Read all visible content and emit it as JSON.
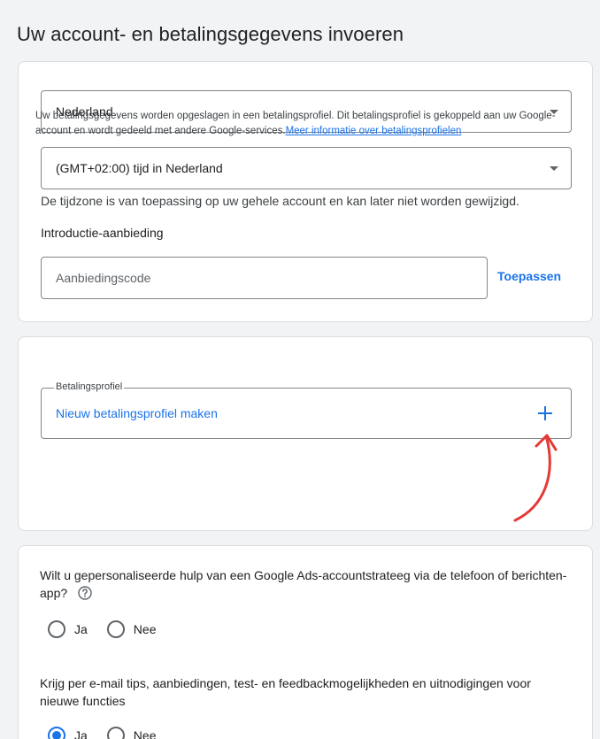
{
  "page": {
    "title": "Uw account- en betalingsgegevens invoeren"
  },
  "account": {
    "country": "Nederland",
    "timezone": "(GMT+02:00) tijd in Nederland",
    "timezone_helper": "De tijdzone is van toepassing op uw gehele account en kan later niet worden gewijzigd.",
    "intro_label": "Introductie-aanbieding",
    "code_placeholder": "Aanbiedingscode",
    "apply_label": "Toepassen"
  },
  "payment": {
    "legend": "Betalingsprofiel",
    "new_profile": "Nieuw betalingsprofiel maken",
    "helper_text": "Uw betalingsgegevens worden opgeslagen in een betalingsprofiel. Dit betalingsprofiel is gekoppeld aan uw Google-account en wordt gedeeld met andere Google-services.",
    "helper_link": "Meer informatie over betalingsprofielen"
  },
  "questions": {
    "q1": "Wilt u gepersonaliseerde hulp van een Google Ads-accountstrateeg via de telefoon of berichten-app?",
    "q1_options": [
      "Ja",
      "Nee"
    ],
    "q1_selected": null,
    "q2": "Krijg per e-mail tips, aanbiedingen, test- en feedbackmogelijkheden en uitnodigingen voor nieuwe functies",
    "q2_options": [
      "Ja",
      "Nee"
    ],
    "q2_selected": "Ja"
  },
  "colors": {
    "accent": "#1a73e8",
    "annotation_arrow": "#e53935"
  },
  "icons": {
    "dropdown": "caret-down-icon",
    "add": "plus-icon",
    "help": "help-circle-icon"
  }
}
